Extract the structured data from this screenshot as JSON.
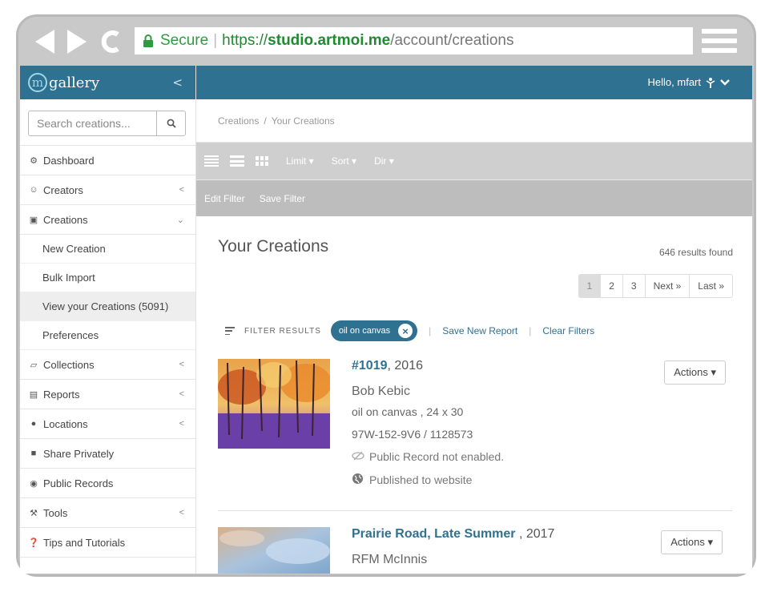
{
  "browser": {
    "secure_label": "Secure",
    "url_scheme": "https://",
    "url_host": "studio.artmoi.me",
    "url_path": "/account/creations"
  },
  "brand": {
    "letter": "m",
    "name": "gallery",
    "collapse_glyph": "<"
  },
  "sidebar": {
    "search_placeholder": "Search creations...",
    "items": [
      {
        "label": "Dashboard",
        "icon": "dashboard-icon",
        "glyph": "⚙",
        "chevron": ""
      },
      {
        "label": "Creators",
        "icon": "users-icon",
        "glyph": "☺",
        "chevron": "<"
      },
      {
        "label": "Creations",
        "icon": "image-icon",
        "glyph": "▣",
        "chevron": "⌄"
      }
    ],
    "subitems": [
      {
        "label": "New Creation",
        "active": false
      },
      {
        "label": "Bulk Import",
        "active": false
      },
      {
        "label": "View your Creations (5091)",
        "active": true
      },
      {
        "label": "Preferences",
        "active": false
      }
    ],
    "items_after": [
      {
        "label": "Collections",
        "icon": "folder-icon",
        "glyph": "▱",
        "chevron": "<"
      },
      {
        "label": "Reports",
        "icon": "report-icon",
        "glyph": "▤",
        "chevron": "<"
      },
      {
        "label": "Locations",
        "icon": "location-icon",
        "glyph": "●",
        "chevron": "<"
      },
      {
        "label": "Share Privately",
        "icon": "lock-icon",
        "glyph": "■",
        "chevron": ""
      },
      {
        "label": "Public Records",
        "icon": "eye-icon",
        "glyph": "◉",
        "chevron": ""
      },
      {
        "label": "Tools",
        "icon": "wrench-icon",
        "glyph": "⚒",
        "chevron": "<"
      },
      {
        "label": "Tips and Tutorials",
        "icon": "question-icon",
        "glyph": "❓",
        "chevron": ""
      }
    ]
  },
  "header": {
    "greeting": "Hello, mfart"
  },
  "breadcrumb": {
    "root": "Creations",
    "sep": "/",
    "current": "Your Creations"
  },
  "toolbar": {
    "limit": "Limit ▾",
    "sort": "Sort ▾",
    "dir": "Dir ▾"
  },
  "filterbar": {
    "edit": "Edit Filter",
    "save": "Save Filter"
  },
  "main": {
    "title": "Your Creations",
    "results": "646 results found",
    "pages": [
      "1",
      "2",
      "3",
      "Next »",
      "Last »"
    ],
    "filter_label": "FILTER RESULTS",
    "chip": "oil on canvas",
    "save_report": "Save New Report",
    "clear_filters": "Clear Filters",
    "items": [
      {
        "title": "#1019",
        "year": ", 2016",
        "artist": "Bob Kebic",
        "medium": "oil on canvas , 24 x 30",
        "code": "97W-152-9V6 / 1128573",
        "status1": "Public Record not enabled.",
        "status2": "Published to website",
        "actions": "Actions ▾"
      },
      {
        "title": "Prairie Road, Late Summer",
        "year": " , 2017",
        "artist": "RFM McInnis",
        "actions": "Actions ▾"
      }
    ]
  },
  "colors": {
    "brand": "#2f7191",
    "toolbar": "#cfcfcf",
    "filterbar": "#bdbdbd",
    "secure": "#2e9b3e"
  }
}
